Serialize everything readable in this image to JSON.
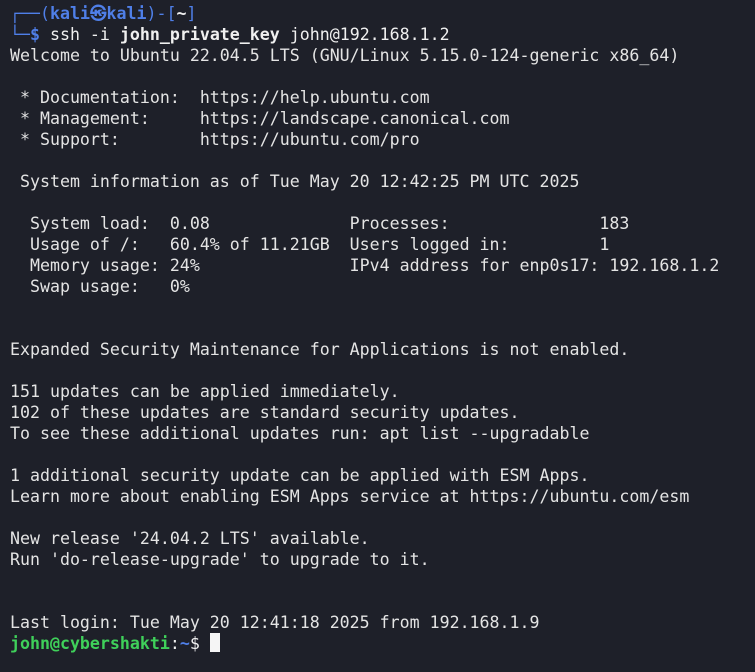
{
  "kali_prompt": {
    "line1_prefix": "┌──(",
    "user": "kali",
    "at_symbol": "㉿",
    "host": "kali",
    "mid": ")-[",
    "dir": "~",
    "close": "]",
    "line2_prefix": "└─",
    "dollar": "$ ",
    "cmd": "ssh -i ",
    "key_arg": "john_private_key",
    "target": " john@192.168.1.2"
  },
  "motd": {
    "welcome": "Welcome to Ubuntu 22.04.5 LTS (GNU/Linux 5.15.0-124-generic x86_64)",
    "docs": " * Documentation:  https://help.ubuntu.com",
    "mgmt": " * Management:     https://landscape.canonical.com",
    "support": " * Support:        https://ubuntu.com/pro",
    "sysinfo": " System information as of Tue May 20 12:42:25 PM UTC 2025",
    "stat1": "  System load:  0.08              Processes:               183",
    "stat2": "  Usage of /:   60.4% of 11.21GB  Users logged in:         1",
    "stat3": "  Memory usage: 24%               IPv4 address for enp0s17: 192.168.1.2",
    "stat4": "  Swap usage:   0%",
    "esm": "Expanded Security Maintenance for Applications is not enabled.",
    "upd1": "151 updates can be applied immediately.",
    "upd2": "102 of these updates are standard security updates.",
    "upd3": "To see these additional updates run: apt list --upgradable",
    "esm1": "1 additional security update can be applied with ESM Apps.",
    "esm2": "Learn more about enabling ESM Apps service at https://ubuntu.com/esm",
    "rel1": "New release '24.04.2 LTS' available.",
    "rel2": "Run 'do-release-upgrade' to upgrade to it.",
    "lastlogin": "Last login: Tue May 20 12:41:18 2025 from 192.168.1.9"
  },
  "remote_prompt": {
    "userhost": "john@cybershakti",
    "colon": ":",
    "path": "~",
    "dollar": "$ "
  },
  "colors": {
    "background": "#1e2029",
    "prompt_blue": "#4f7fe8",
    "prompt_green": "#3fd05a",
    "text": "#e4e4e4"
  }
}
